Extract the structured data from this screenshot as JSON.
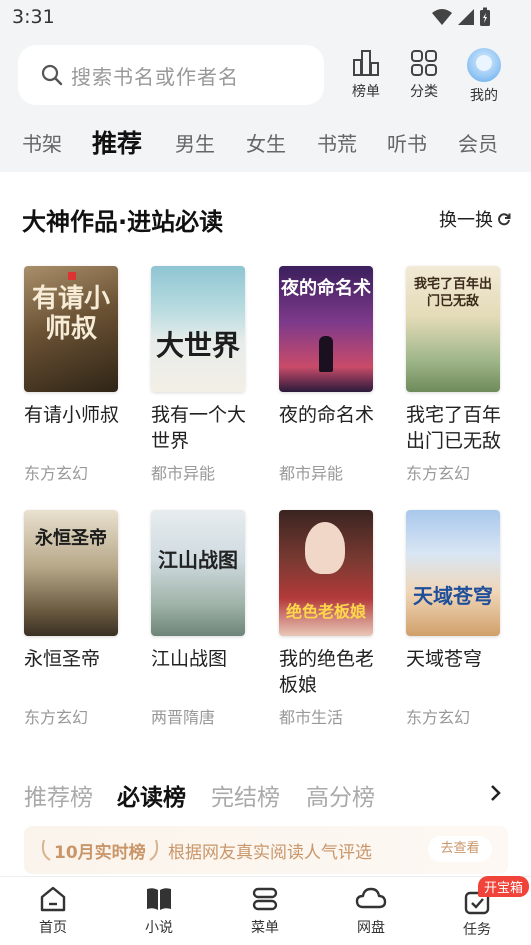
{
  "status_bar": {
    "time": "3:31"
  },
  "search": {
    "placeholder": "搜索书名或作者名"
  },
  "top_buttons": [
    {
      "label": "榜单",
      "icon": "ranking-icon"
    },
    {
      "label": "分类",
      "icon": "category-grid-icon"
    },
    {
      "label": "我的",
      "icon": "avatar"
    }
  ],
  "channel_tabs": [
    "书架",
    "推荐",
    "男生",
    "女生",
    "书荒",
    "听书",
    "会员"
  ],
  "channel_active": "推荐",
  "section": {
    "title": "大神作品·进站必读",
    "refresh_label": "换一换"
  },
  "books": [
    {
      "title": "有请小师叔",
      "genre": "东方玄幻",
      "cover_text": "有请小师叔"
    },
    {
      "title": "我有一个大世界",
      "genre": "都市异能",
      "cover_text": "大世界"
    },
    {
      "title": "夜的命名术",
      "genre": "都市异能",
      "cover_text": "夜的命名术"
    },
    {
      "title": "我宅了百年出门已无敌",
      "genre": "东方玄幻",
      "cover_text": "我宅了百年出门已无敌"
    },
    {
      "title": "永恒圣帝",
      "genre": "东方玄幻",
      "cover_text": "永恒圣帝"
    },
    {
      "title": "江山战图",
      "genre": "两晋隋唐",
      "cover_text": "江山战图"
    },
    {
      "title": "我的绝色老板娘",
      "genre": "都市生活",
      "cover_text": "绝色老板娘"
    },
    {
      "title": "天域苍穹",
      "genre": "东方玄幻",
      "cover_text": "天域苍穹"
    }
  ],
  "rank_tabs": [
    "推荐榜",
    "必读榜",
    "完结榜",
    "高分榜"
  ],
  "rank_active": "必读榜",
  "banner": {
    "title": "10月实时榜",
    "text": "根据网友真实阅读人气评选",
    "button": "去查看"
  },
  "bottom_nav": [
    {
      "label": "首页",
      "icon": "home-icon"
    },
    {
      "label": "小说",
      "icon": "book-icon"
    },
    {
      "label": "菜单",
      "icon": "menu-icon"
    },
    {
      "label": "网盘",
      "icon": "cloud-icon"
    },
    {
      "label": "任务",
      "icon": "task-icon"
    }
  ],
  "task_badge": "开宝箱",
  "colors": {
    "accent": "#c9966a",
    "badge": "#f0433a",
    "header_bg": "#f3f4f6"
  }
}
